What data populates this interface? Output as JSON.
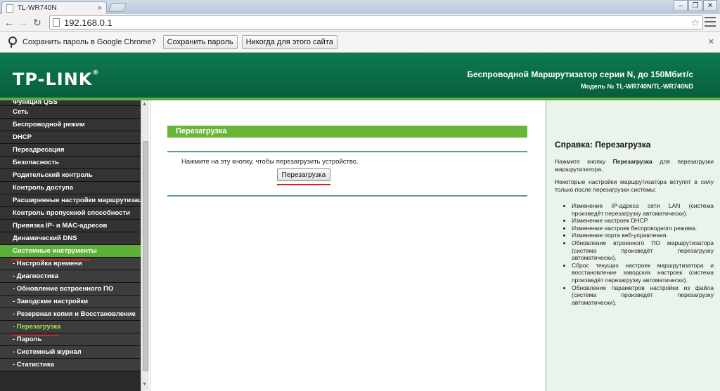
{
  "browser": {
    "tab_title": "TL-WR740N",
    "url": "192.168.0.1",
    "infobar_message": "Сохранить пароль в Google Chrome?",
    "save_password_label": "Сохранить пароль",
    "never_label": "Никогда для этого сайта"
  },
  "header": {
    "logo": "TP-LINK",
    "title": "Беспроводной Маршрутизатор серии N, до 150Мбит/с",
    "model": "Модель № TL-WR740N/TL-WR740ND"
  },
  "sidebar": {
    "items": [
      {
        "label": "Функция QSS"
      },
      {
        "label": "Сеть"
      },
      {
        "label": "Беспроводной режим"
      },
      {
        "label": "DHCP"
      },
      {
        "label": "Переадресация"
      },
      {
        "label": "Безопасность"
      },
      {
        "label": "Родительский контроль"
      },
      {
        "label": "Контроль доступа"
      },
      {
        "label": "Расширенные настройки маршрутизации"
      },
      {
        "label": "Контроль пропускной способности"
      },
      {
        "label": "Привязка IP- и MAC-адресов"
      },
      {
        "label": "Динамический DNS"
      },
      {
        "label": "Системные инструменты"
      },
      {
        "label": "- Настройка времени"
      },
      {
        "label": "- Диагностика"
      },
      {
        "label": "- Обновление встроенного ПО"
      },
      {
        "label": "- Заводские настройки"
      },
      {
        "label": "- Резервная копия и Восстановление"
      },
      {
        "label": "- Перезагрузка"
      },
      {
        "label": "- Пароль"
      },
      {
        "label": "- Системный журнал"
      },
      {
        "label": "- Статистика"
      }
    ]
  },
  "main": {
    "title": "Перезагрузка",
    "description": "Нажмите на эту кнопку, чтобы перезагрузить устройство.",
    "reboot_button": "Перезагрузка"
  },
  "help": {
    "title": "Справка: Перезагрузка",
    "p1_prefix": "Нажмите кнопку ",
    "p1_bold": "Перезагрузка",
    "p1_suffix": " для перезагрузки маршрутизатора.",
    "p2": "Некоторые настройки маршрутизатора вступят в силу только после перезагрузки системы:",
    "list": [
      "Изменение IP-адреса сети LAN (система произведёт перезагрузку автоматически).",
      "Изменение настроек DHCP.",
      "Изменение настроек беспроводного режима.",
      "Изменение порта веб-управления.",
      "Обновление втроенного ПО маршрутизатора (система произведёт перезагрузку автоматически).",
      "Сброс текущих настроек маршрутизатора и восстановление заводских настроек (система произведёт перезагрузку автоматически).",
      "Обновление параметров настройки из файла (система произведёт перезагрузку автоматически)."
    ]
  },
  "colors": {
    "header_green": "#0a6a46",
    "accent_green": "#69b536",
    "sidebar_bg": "#333333",
    "help_bg": "#eaf4ea",
    "underline_red": "#d32020"
  }
}
